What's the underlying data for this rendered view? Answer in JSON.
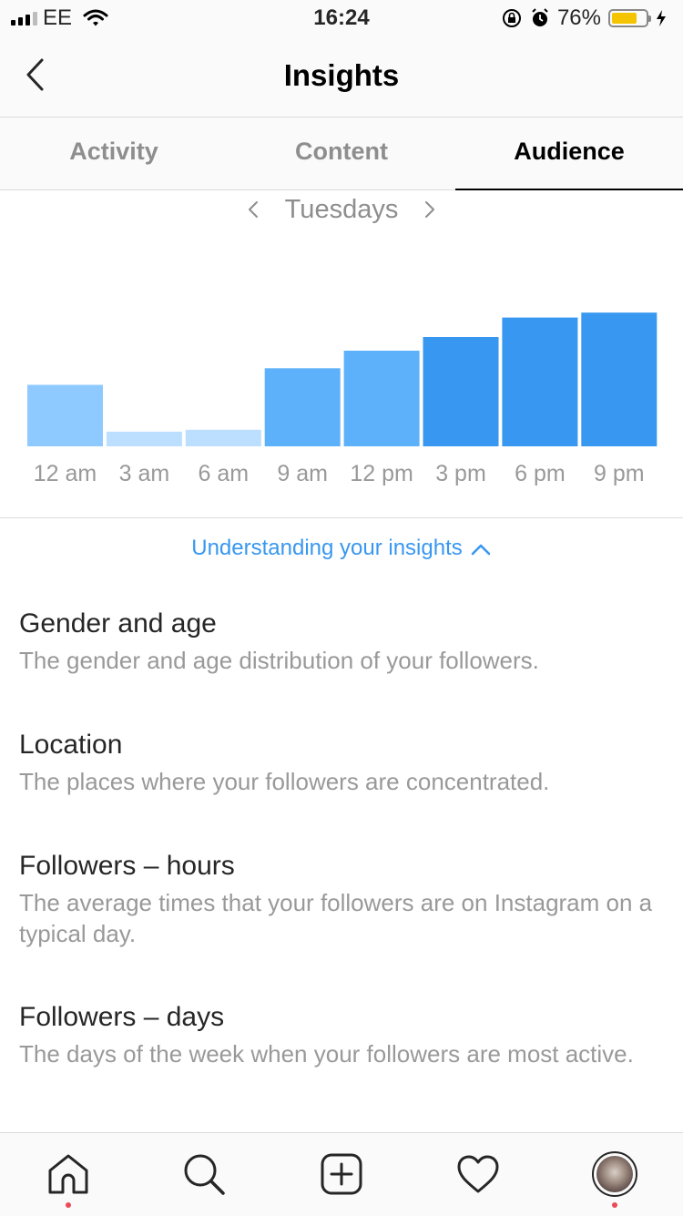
{
  "status_bar": {
    "carrier": "EE",
    "time": "16:24",
    "battery_percent": "76%",
    "battery_level": 0.76,
    "battery_color": "#f5c400"
  },
  "nav": {
    "title": "Insights"
  },
  "tabs": [
    {
      "label": "Activity",
      "active": false
    },
    {
      "label": "Content",
      "active": false
    },
    {
      "label": "Audience",
      "active": true
    }
  ],
  "day_selector": {
    "label": "Tuesdays"
  },
  "chart_data": {
    "type": "bar",
    "categories": [
      "12 am",
      "3 am",
      "6 am",
      "9 am",
      "12 pm",
      "3 pm",
      "6 pm",
      "9 pm"
    ],
    "values": [
      63,
      15,
      17,
      80,
      98,
      112,
      132,
      137
    ],
    "ylim": [
      0,
      140
    ],
    "colors": [
      "#8ecaff",
      "#bcdfff",
      "#bcdfff",
      "#5cb1fa",
      "#5cb1fa",
      "#3897f0",
      "#3897f0",
      "#3897f0"
    ],
    "grid": false
  },
  "understanding": {
    "label": "Understanding your insights",
    "accent": "#3897f0"
  },
  "info_items": [
    {
      "title": "Gender and age",
      "description": "The gender and age distribution of your followers."
    },
    {
      "title": "Location",
      "description": "The places where your followers are concentrated."
    },
    {
      "title": "Followers – hours",
      "description": "The average times that your followers are on Instagram on a typical day."
    },
    {
      "title": "Followers – days",
      "description": "The days of the week when your followers are most active."
    }
  ],
  "tab_bar": {
    "items": [
      "home-icon",
      "search-icon",
      "new-post-icon",
      "activity-heart-icon",
      "profile-avatar"
    ],
    "notification_color": "#ed4956"
  }
}
